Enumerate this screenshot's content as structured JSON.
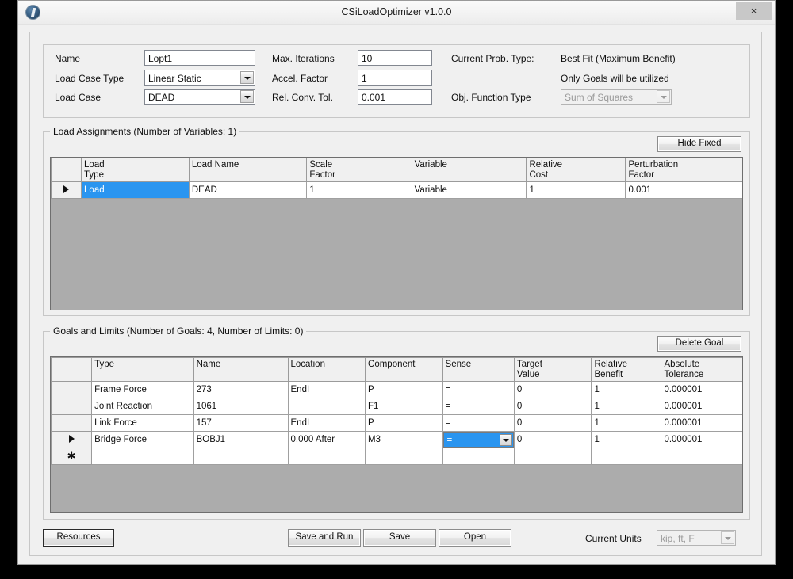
{
  "window": {
    "title": "CSiLoadOptimizer v1.0.0",
    "close_label": "×",
    "app_icon": "app-logo-icon"
  },
  "parameters": {
    "name_label": "Name",
    "name_value": "Lopt1",
    "load_case_type_label": "Load Case Type",
    "load_case_type_value": "Linear Static",
    "load_case_label": "Load Case",
    "load_case_value": "DEAD",
    "max_iterations_label": "Max. Iterations",
    "max_iterations_value": "10",
    "accel_factor_label": "Accel. Factor",
    "accel_factor_value": "1",
    "rel_conv_tol_label": "Rel. Conv. Tol.",
    "rel_conv_tol_value": "0.001",
    "current_prob_type_label": "Current Prob. Type:",
    "current_prob_type_value": "Best Fit (Maximum Benefit)",
    "goals_note": "Only Goals will be utilized",
    "obj_function_type_label": "Obj. Function Type",
    "obj_function_type_value": "Sum of Squares"
  },
  "load_assignments": {
    "group_title": "Load Assignments    (Number of Variables: 1)",
    "hide_fixed_label": "Hide Fixed",
    "columns": [
      "",
      "Load\nType",
      "Load Name",
      "Scale\nFactor",
      "Variable",
      "Relative\nCost",
      "Perturbation\nFactor"
    ],
    "columns_display": [
      {
        "line1": "",
        "line2": ""
      },
      {
        "line1": "Load",
        "line2": "Type"
      },
      {
        "line1": "Load Name",
        "line2": ""
      },
      {
        "line1": "Scale",
        "line2": "Factor"
      },
      {
        "line1": "Variable",
        "line2": ""
      },
      {
        "line1": "Relative",
        "line2": "Cost"
      },
      {
        "line1": "Perturbation",
        "line2": "Factor"
      }
    ],
    "rows": [
      {
        "marker": "▶",
        "load_type": "Load",
        "load_name": "DEAD",
        "scale_factor": "1",
        "variable": "Variable",
        "relative_cost": "1",
        "perturbation_factor": "0.001",
        "selected_cell": "load_type"
      }
    ]
  },
  "goals_and_limits": {
    "group_title": "Goals and Limits    (Number of Goals: 4,  Number of Limits: 0)",
    "delete_goal_label": "Delete Goal",
    "columns_display": [
      {
        "line1": "",
        "line2": ""
      },
      {
        "line1": "Type",
        "line2": ""
      },
      {
        "line1": "Name",
        "line2": ""
      },
      {
        "line1": "Location",
        "line2": ""
      },
      {
        "line1": "Component",
        "line2": ""
      },
      {
        "line1": "Sense",
        "line2": ""
      },
      {
        "line1": "Target",
        "line2": "Value"
      },
      {
        "line1": "Relative",
        "line2": "Benefit"
      },
      {
        "line1": "Absolute",
        "line2": "Tolerance"
      }
    ],
    "rows": [
      {
        "marker": "",
        "type": "Frame Force",
        "name": "273",
        "location": "EndI",
        "component": "P",
        "sense": "=",
        "target_value": "0",
        "relative_benefit": "1",
        "absolute_tolerance": "0.000001",
        "sense_is_dropdown": false
      },
      {
        "marker": "",
        "type": "Joint Reaction",
        "name": "1061",
        "location": "",
        "component": "F1",
        "sense": "=",
        "target_value": "0",
        "relative_benefit": "1",
        "absolute_tolerance": "0.000001",
        "sense_is_dropdown": false
      },
      {
        "marker": "",
        "type": "Link Force",
        "name": "157",
        "location": "EndI",
        "component": "P",
        "sense": "=",
        "target_value": "0",
        "relative_benefit": "1",
        "absolute_tolerance": "0.000001",
        "sense_is_dropdown": false
      },
      {
        "marker": "▶",
        "type": "Bridge Force",
        "name": "BOBJ1",
        "location": "0.000 After",
        "component": "M3",
        "sense": "=",
        "target_value": "0",
        "relative_benefit": "1",
        "absolute_tolerance": "0.000001",
        "sense_is_dropdown": true
      },
      {
        "marker": "✱",
        "type": "",
        "name": "",
        "location": "",
        "component": "",
        "sense": "",
        "target_value": "",
        "relative_benefit": "",
        "absolute_tolerance": "",
        "sense_is_dropdown": false
      }
    ]
  },
  "footer": {
    "resources_label": "Resources",
    "save_and_run_label": "Save and Run",
    "save_label": "Save",
    "open_label": "Open",
    "current_units_label": "Current Units",
    "current_units_value": "kip, ft, F"
  },
  "colors": {
    "selection_blue": "#2a95f0",
    "window_bg": "#f0f0f0",
    "grid_empty": "#acacac",
    "border": "#c7c7c7"
  }
}
